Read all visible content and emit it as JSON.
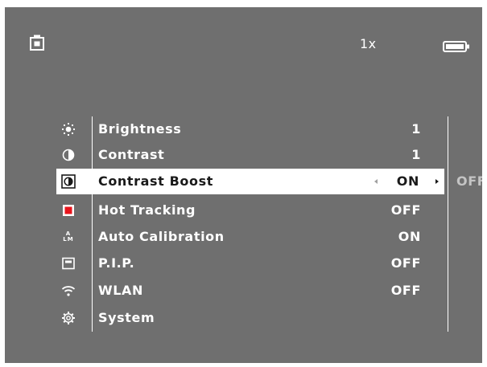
{
  "status": {
    "camera_icon": "camera-mode-icon",
    "zoom": "1x",
    "battery_icon": "battery-full-icon"
  },
  "menu": {
    "items": [
      {
        "icon": "brightness-icon",
        "label": "Brightness",
        "value": "1"
      },
      {
        "icon": "contrast-icon",
        "label": "Contrast",
        "value": "1"
      },
      {
        "icon": "contrast-boost-icon",
        "label": "Contrast Boost",
        "value": "ON",
        "selected": true,
        "alt_option": "OFF"
      },
      {
        "icon": "hot-tracking-icon",
        "label": "Hot Tracking",
        "value": "OFF",
        "icon_color": "#e8141c"
      },
      {
        "icon": "auto-calibration-icon",
        "label": "Auto Calibration",
        "value": "ON",
        "icon_text": {
          "top": "A",
          "bottom": "LM"
        }
      },
      {
        "icon": "pip-icon",
        "label": "P.I.P.",
        "value": "OFF"
      },
      {
        "icon": "wlan-icon",
        "label": "WLAN",
        "value": "OFF"
      },
      {
        "icon": "system-gear-icon",
        "label": "System",
        "value": ""
      }
    ]
  },
  "colors": {
    "screen_bg": "#6f6f6f",
    "text": "#ffffff",
    "highlight": "#ffffff",
    "highlight_text": "#1a1a1a",
    "hot_tracking": "#e8141c"
  }
}
